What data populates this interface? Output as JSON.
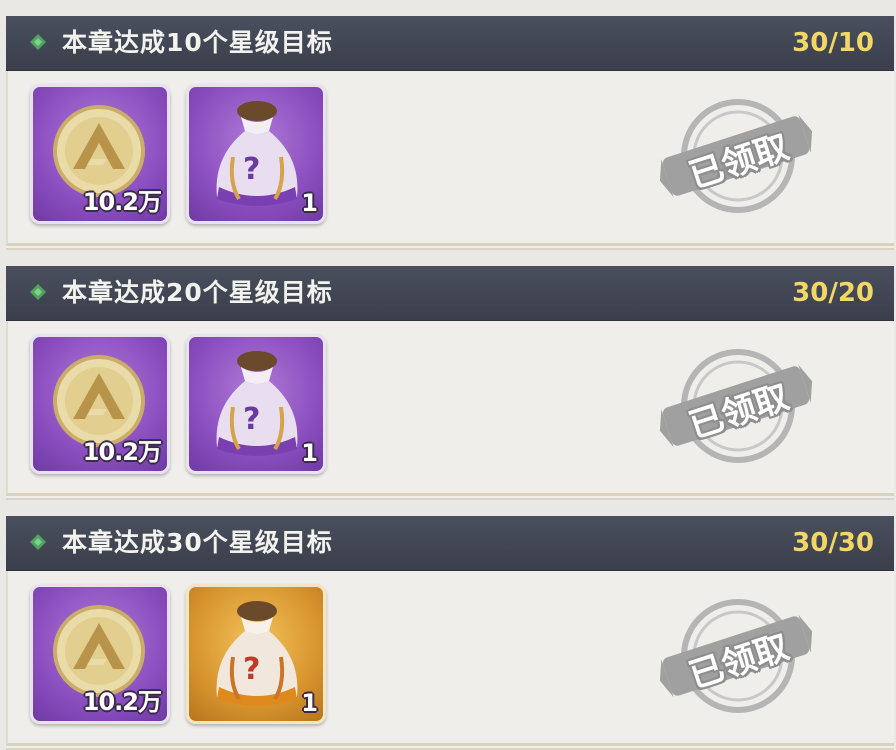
{
  "missions": [
    {
      "title": "本章达成10个星级目标",
      "progress": "30/10",
      "rewards": [
        {
          "icon": "gold-coin-icon",
          "qty": "10.2万",
          "rarity": "purple"
        },
        {
          "icon": "mystery-bag-icon",
          "qty": "1",
          "rarity": "purple"
        }
      ],
      "status": "已领取"
    },
    {
      "title": "本章达成20个星级目标",
      "progress": "30/20",
      "rewards": [
        {
          "icon": "gold-coin-icon",
          "qty": "10.2万",
          "rarity": "purple"
        },
        {
          "icon": "mystery-bag-icon",
          "qty": "1",
          "rarity": "purple"
        }
      ],
      "status": "已领取"
    },
    {
      "title": "本章达成30个星级目标",
      "progress": "30/30",
      "rewards": [
        {
          "icon": "gold-coin-icon",
          "qty": "10.2万",
          "rarity": "purple"
        },
        {
          "icon": "mystery-bag-icon",
          "qty": "1",
          "rarity": "gold"
        }
      ],
      "status": "已领取"
    }
  ],
  "colors": {
    "header_bg": "#3f4350",
    "progress_text": "#f1d765",
    "diamond": "#4fa55f",
    "rarity_purple": "#8b4fc0",
    "rarity_gold": "#d8952e",
    "stamp": "#9a9a9a"
  }
}
